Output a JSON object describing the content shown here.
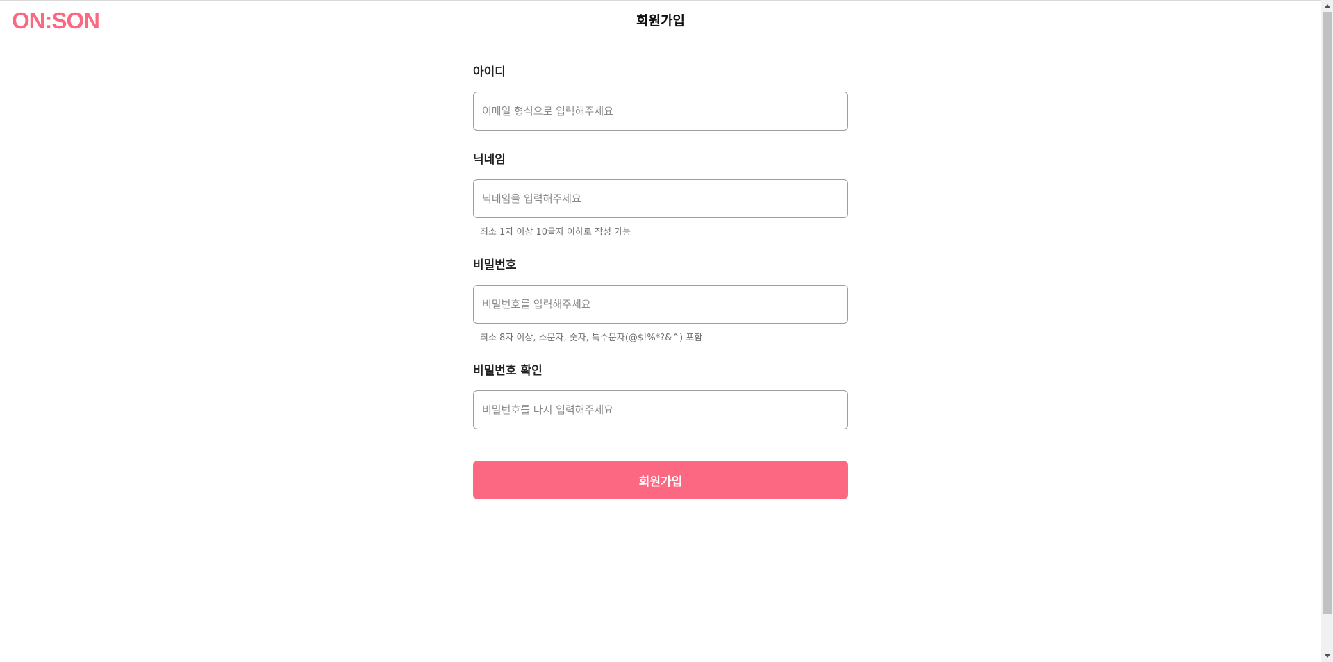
{
  "brand": {
    "logo_text": "ON:SON",
    "accent_color": "#fc6782"
  },
  "header": {
    "title": "회원가입"
  },
  "form": {
    "fields": [
      {
        "label": "아이디",
        "placeholder": "이메일 형식으로 입력해주세요",
        "value": "",
        "hint": ""
      },
      {
        "label": "닉네임",
        "placeholder": "닉네임을 입력해주세요",
        "value": "",
        "hint": "최소 1자 이상 10글자 이하로 작성 가능"
      },
      {
        "label": "비밀번호",
        "placeholder": "비밀번호를 입력해주세요",
        "value": "",
        "hint": "최소 8자 이상, 소문자, 숫자, 특수문자(@$!%*?&^) 포함"
      },
      {
        "label": "비밀번호 확인",
        "placeholder": "비밀번호를 다시 입력해주세요",
        "value": "",
        "hint": ""
      }
    ],
    "submit_label": "회원가입"
  },
  "icons": {
    "scroll_up": "scroll-up-arrow-icon",
    "scroll_down": "scroll-down-arrow-icon"
  }
}
